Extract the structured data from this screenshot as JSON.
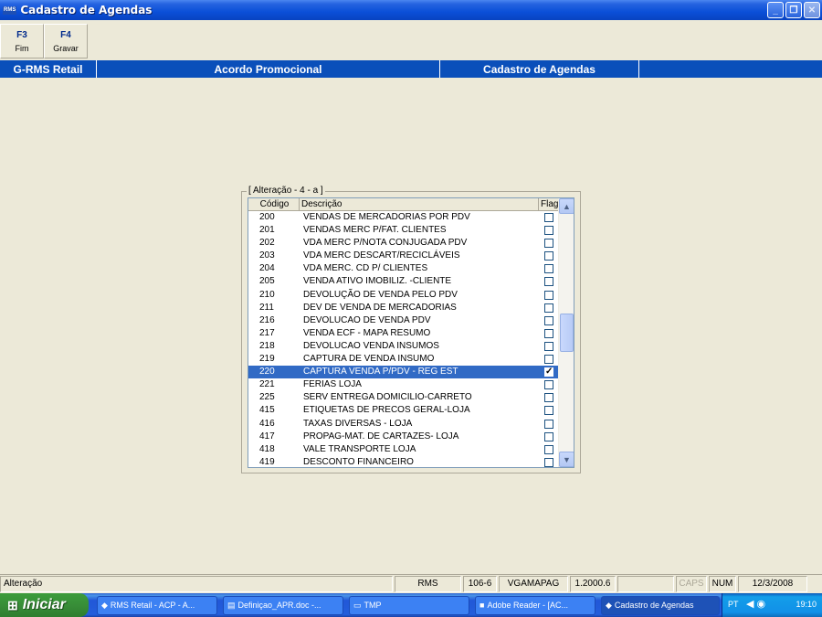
{
  "window": {
    "app_icon_text": "RMS",
    "title": "Cadastro de Agendas",
    "minimize": "_",
    "maximize": "❐",
    "close": "✕"
  },
  "toolbar": {
    "buttons": [
      {
        "key": "F3",
        "label": "Fim"
      },
      {
        "key": "F4",
        "label": "Gravar"
      }
    ]
  },
  "header_strip": {
    "cells": [
      "G-RMS Retail",
      "Acordo Promocional",
      "Cadastro de Agendas"
    ],
    "color": "#0a4fba"
  },
  "group": {
    "legend": "[ Alteração  - 4 - a  ]",
    "columns": [
      "Código",
      "Descrição",
      "Flag"
    ],
    "rows": [
      {
        "code": "200",
        "desc": "VENDAS DE MERCADORIAS POR PDV",
        "flag": false
      },
      {
        "code": "201",
        "desc": "VENDAS MERC P/FAT. CLIENTES",
        "flag": false
      },
      {
        "code": "202",
        "desc": "VDA MERC P/NOTA CONJUGADA PDV",
        "flag": false
      },
      {
        "code": "203",
        "desc": "VDA MERC DESCART/RECICLÁVEIS",
        "flag": false
      },
      {
        "code": "204",
        "desc": "VDA MERC. CD P/ CLIENTES",
        "flag": false
      },
      {
        "code": "205",
        "desc": "VENDA ATIVO IMOBILIZ. -CLIENTE",
        "flag": false
      },
      {
        "code": "210",
        "desc": "DEVOLUÇÃO DE VENDA PELO PDV",
        "flag": false
      },
      {
        "code": "211",
        "desc": "DEV DE VENDA DE MERCADORIAS",
        "flag": false
      },
      {
        "code": "216",
        "desc": "DEVOLUCAO DE VENDA PDV",
        "flag": false
      },
      {
        "code": "217",
        "desc": "VENDA ECF - MAPA RESUMO",
        "flag": false
      },
      {
        "code": "218",
        "desc": "DEVOLUCAO VENDA INSUMOS",
        "flag": false
      },
      {
        "code": "219",
        "desc": "CAPTURA DE VENDA INSUMO",
        "flag": false
      },
      {
        "code": "220",
        "desc": "CAPTURA VENDA P/PDV - REG EST",
        "flag": true,
        "selected": true
      },
      {
        "code": "221",
        "desc": "FERIAS LOJA",
        "flag": false
      },
      {
        "code": "225",
        "desc": "SERV ENTREGA DOMICILIO-CARRETO",
        "flag": false
      },
      {
        "code": "415",
        "desc": "ETIQUETAS DE PRECOS GERAL-LOJA",
        "flag": false
      },
      {
        "code": "416",
        "desc": "TAXAS DIVERSAS - LOJA",
        "flag": false
      },
      {
        "code": "417",
        "desc": "PROPAG-MAT. DE CARTAZES- LOJA",
        "flag": false
      },
      {
        "code": "418",
        "desc": "VALE TRANSPORTE LOJA",
        "flag": false
      },
      {
        "code": "419",
        "desc": "DESCONTO FINANCEIRO",
        "flag": false
      }
    ]
  },
  "statusbar": {
    "mode": "Alteração",
    "system": "RMS",
    "code": "106-6",
    "program": "VGAMAPAG",
    "version": "1.2000.6",
    "empty": "",
    "caps": "CAPS",
    "num": "NUM",
    "date": "12/3/2008"
  },
  "taskbar": {
    "start": "Iniciar",
    "tasks": [
      {
        "icon": "rms-icon",
        "label": "RMS Retail - ACP - A..."
      },
      {
        "icon": "word-doc-icon",
        "label": "Definiçao_APR.doc -..."
      },
      {
        "icon": "folder-icon",
        "label": "TMP"
      },
      {
        "icon": "adobe-reader-icon",
        "label": "Adobe Reader - [AC..."
      },
      {
        "icon": "rms-icon",
        "label": "Cadastro de Agendas",
        "active": true
      }
    ],
    "lang": "PT",
    "time": "19:10"
  }
}
